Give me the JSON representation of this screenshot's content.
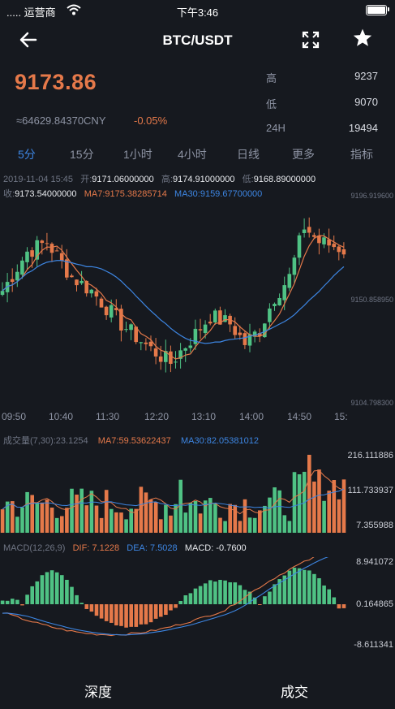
{
  "status_bar": {
    "carrier": "..... 运营商",
    "time": "下午3:46"
  },
  "header": {
    "title": "BTC/USDT",
    "back_icon": "arrow-left-icon",
    "expand_icon": "fullscreen-icon",
    "star_icon": "star-icon"
  },
  "ticker": {
    "price": "9173.86",
    "cny": "≈64629.84370CNY",
    "change": "-0.05%",
    "high_label": "高",
    "high_value": "9237",
    "low_label": "低",
    "low_value": "9070",
    "vol_label": "24H",
    "vol_value": "19494"
  },
  "tabs": [
    "5分",
    "15分",
    "1小时",
    "4小时",
    "日线",
    "更多",
    "指标"
  ],
  "active_tab": "5分",
  "candle_info": {
    "datetime": "2019-11-04 15:45",
    "open_label": "开:",
    "open": "9171.06000000",
    "high_label": "高:",
    "high": "9174.91000000",
    "low_label": "低:",
    "low": "9168.89000000",
    "close_label": "收:",
    "close": "9173.54000000",
    "ma7_label": "MA7:",
    "ma7": "9175.38285714",
    "ma30_label": "MA30:",
    "ma30": "9159.67700000"
  },
  "price_axis": {
    "top": "9196.919600",
    "mid": "9150.858950",
    "bottom": "9104.798300"
  },
  "time_axis": [
    "09:50",
    "10:40",
    "11:30",
    "12:20",
    "13:10",
    "14:00",
    "14:50",
    "15:"
  ],
  "volume_info": {
    "label": "成交量(7,30):",
    "value": "23.1254",
    "ma7_label": "MA7:",
    "ma7": "59.53622437",
    "ma30_label": "MA30:",
    "ma30": "82.05381012"
  },
  "volume_axis": {
    "top": "216.111886",
    "mid": "111.733937",
    "bottom": "7.355988"
  },
  "macd_info": {
    "label": "MACD(12,26,9)",
    "dif_label": "DIF:",
    "dif": "7.1228",
    "dea_label": "DEA:",
    "dea": "7.5028",
    "macd_label": "MACD:",
    "macd": "-0.7600"
  },
  "macd_axis": {
    "top": "8.941072",
    "mid": "0.164865",
    "bottom": "-8.611341"
  },
  "bottom_actions": {
    "depth": "深度",
    "trades": "成交"
  },
  "colors": {
    "up": "#4fc284",
    "down": "#e5794a",
    "ma7": "#e5794a",
    "ma30": "#3d86e3",
    "accent": "#3d86e3",
    "background": "#16191f"
  }
}
